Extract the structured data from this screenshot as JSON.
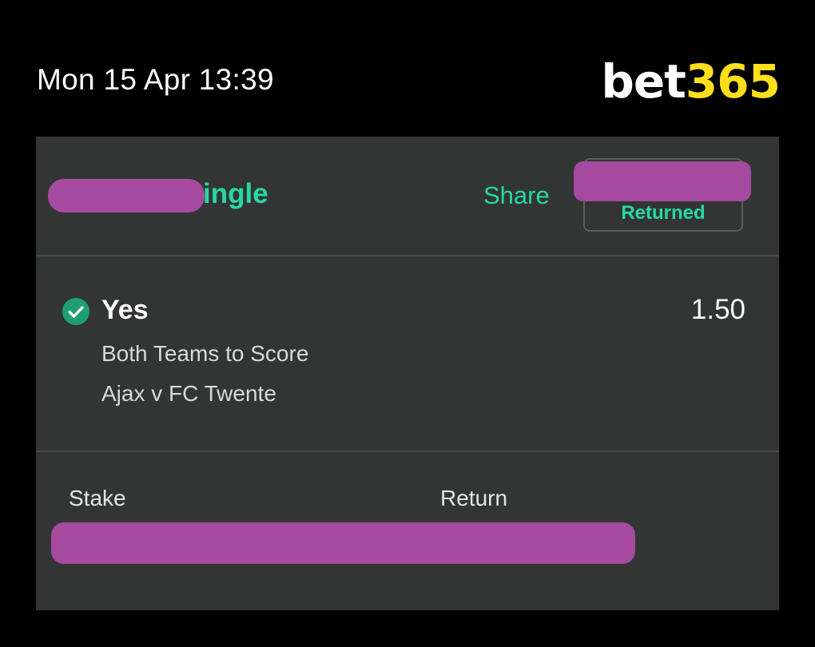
{
  "status_bar": {
    "datetime": "Mon 15 Apr 13:39"
  },
  "logo": {
    "text_bet": "bet",
    "text_num": "365",
    "colors": {
      "bet": "#ffffff",
      "num": "#ffdf1b"
    }
  },
  "bet": {
    "type_visible": "ingle",
    "share_label": "Share",
    "status_label": "Returned"
  },
  "selection": {
    "name": "Yes",
    "status_icon": "check-circle-icon",
    "odds": "1.50",
    "market": "Both Teams to Score",
    "event": "Ajax v FC Twente"
  },
  "totals": {
    "stake_label": "Stake",
    "return_label": "Return"
  },
  "colors": {
    "accent": "#26d9a3",
    "check": "#1f9e73",
    "card_bg": "#323534",
    "redaction": "#a64aa0"
  }
}
